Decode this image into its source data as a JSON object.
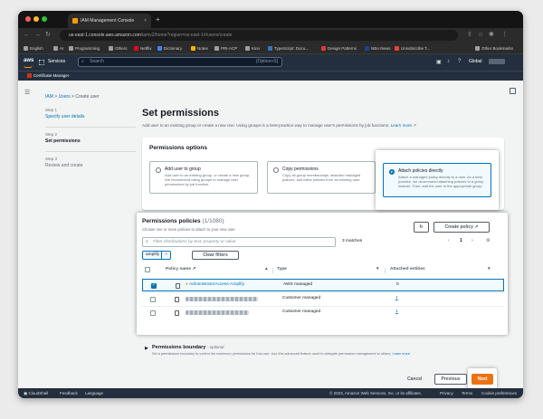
{
  "browser": {
    "tab_title": "IAM Management Console",
    "tab_close": "×",
    "new_tab": "+",
    "url_host": "us-east-1.console.aws.amazon.com",
    "url_path": "/iamv2/home?region=us-east-1#/users/create",
    "bookmarks": [
      "English",
      "AI",
      "Programming",
      "Others",
      "Netflix",
      "Dictionary",
      "Notes",
      "PRI-ACP",
      "Kino",
      "TypeScript: Docu...",
      "Design Patterns",
      "NBA News",
      "Unsubscribe T...",
      "Other Bookmarks"
    ]
  },
  "aws_header": {
    "logo": "aws",
    "services": "Services",
    "search_placeholder": "Search",
    "search_shortcut": "[Option+S]",
    "region": "Global",
    "service_name": "Certificate Manager"
  },
  "breadcrumb": {
    "iam": "IAM",
    "users": "Users",
    "current": "Create user",
    "sep": ">"
  },
  "steps": [
    {
      "label": "Step 1",
      "name": "Specify user details"
    },
    {
      "label": "Step 2",
      "name": "Set permissions"
    },
    {
      "label": "Step 3",
      "name": "Review and create"
    }
  ],
  "page": {
    "title": "Set permissions",
    "subtitle": "Add user to an existing group or create a new one. Using groups is a best-practice way to manage user's permissions by job functions.",
    "learn_more": "Learn more"
  },
  "permissions_options": {
    "title": "Permissions options",
    "options": [
      {
        "title": "Add user to group",
        "desc": "Add user to an existing group, or create a new group. We recommend using groups to manage user permissions by job function.",
        "selected": false
      },
      {
        "title": "Copy permissions",
        "desc": "Copy all group memberships, attached managed policies, and inline policies from an existing user.",
        "selected": false
      },
      {
        "title": "Attach policies directly",
        "desc": "Attach a managed policy directly to a user. As a best practice, we recommend attaching policies to a group instead. Then, add the user to the appropriate group.",
        "selected": true
      }
    ]
  },
  "policies": {
    "title": "Permissions policies",
    "count": "(1/1080)",
    "desc": "Choose one or more policies to attach to your new user.",
    "refresh_icon": "refresh-icon",
    "create_label": "Create policy",
    "filter_placeholder": "Filter distributions by text, property or value",
    "matches": "3 matches",
    "page_num": "1",
    "token": "amplify",
    "token_x": "×",
    "clear_label": "Clear filters",
    "col_name": "Policy name",
    "col_type": "Type",
    "col_entities": "Attached entities",
    "rows": [
      {
        "name": "AdministratorAccess-Amplify",
        "type": "AWS managed",
        "entities": "0",
        "checked": true
      },
      {
        "name": "",
        "type": "Customer managed",
        "entities": "1",
        "checked": false
      },
      {
        "name": "",
        "type": "Customer managed",
        "entities": "1",
        "checked": false
      }
    ]
  },
  "boundary": {
    "title": "Permissions boundary",
    "optional": "- optional",
    "desc": "Set a permissions boundary to control the maximum permissions for this user. Use this advanced feature used to delegate permission management to others.",
    "learn_more": "Learn more"
  },
  "actions": {
    "cancel": "Cancel",
    "previous": "Previous",
    "next": "Next"
  },
  "footer": {
    "cloudshell": "CloudShell",
    "feedback": "Feedback",
    "language": "Language",
    "copyright": "© 2023, Amazon Web Services, Inc. or its affiliates.",
    "privacy": "Privacy",
    "terms": "Terms",
    "cookie": "Cookie preferences"
  },
  "colors": {
    "aws_nav": "#232f3e",
    "primary": "#ec7211",
    "link": "#0073bb"
  }
}
